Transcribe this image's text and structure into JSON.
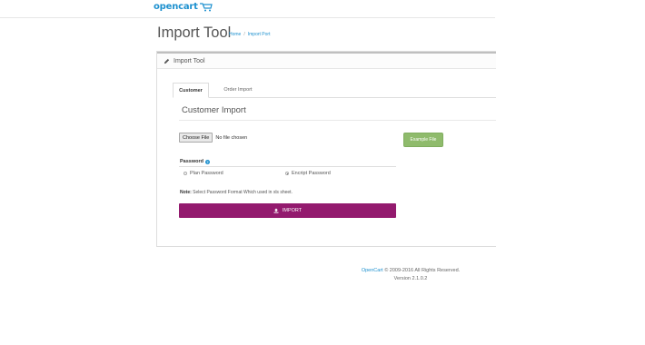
{
  "header": {
    "logo_text": "opencart",
    "logo_icon": "cart-icon"
  },
  "page": {
    "title": "Import Tool",
    "breadcrumbs": [
      "Home",
      "Import Port"
    ],
    "breadcrumb_separator": "/"
  },
  "panel": {
    "title": "Import Tool",
    "title_icon": "pencil-icon",
    "tabs": [
      {
        "label": "Customer",
        "active": true
      },
      {
        "label": "Order Import",
        "active": false
      }
    ],
    "section_title": "Customer Import",
    "file_input": {
      "button_label": "Choose File",
      "status": "No file chosen"
    },
    "example_button": "Example File",
    "password": {
      "label": "Password",
      "help_icon": "?",
      "options": [
        {
          "label": "Plan Password",
          "selected": false
        },
        {
          "label": "Encript Password",
          "selected": true
        }
      ]
    },
    "note_prefix": "Note:",
    "note_text": "Select Password Format Which used in xls sheet.",
    "import_button": "IMPORT",
    "import_icon": "upload-icon"
  },
  "footer": {
    "brand": "OpenCart",
    "copyright": "© 2009-2016 All Rights Reserved.",
    "version": "Version 2.1.0.2"
  },
  "colors": {
    "brand_blue": "#1e91cf",
    "import_button": "#931a6e",
    "example_button": "#8fbb6c"
  }
}
